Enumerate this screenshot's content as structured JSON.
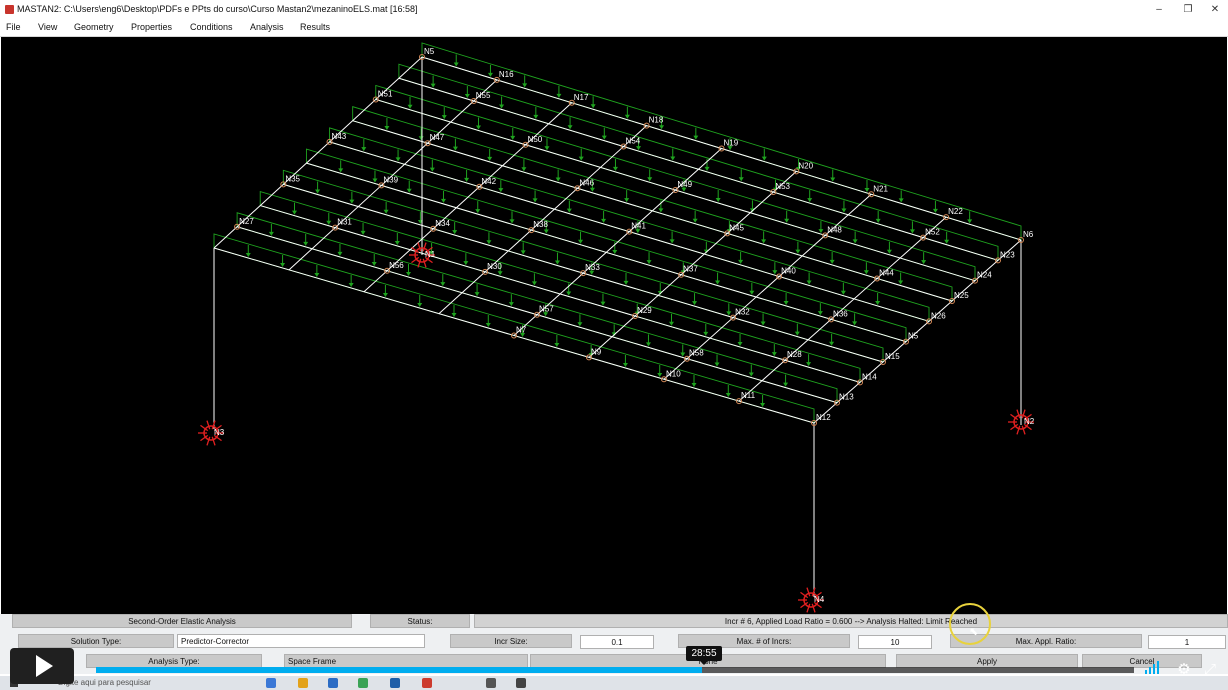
{
  "window": {
    "title": "MASTAN2:  C:\\Users\\eng6\\Desktop\\PDFs e PPts do curso\\Curso Mastan2\\mezaninoELS.mat",
    "time": "[16:58]",
    "minimize": "–",
    "restore": "❐",
    "close": "✕"
  },
  "menu": [
    "File",
    "View",
    "Geometry",
    "Properties",
    "Conditions",
    "Analysis",
    "Results"
  ],
  "nodes": {
    "primary": [
      "N5",
      "N16",
      "N17",
      "N18",
      "N19",
      "N20",
      "N21",
      "N22",
      "N6",
      "N23",
      "N24",
      "N25",
      "N26",
      "N5",
      "N15",
      "N14",
      "N13",
      "N12",
      "N11",
      "N10",
      "N9",
      "N7"
    ],
    "interior": [
      "N55",
      "N54",
      "N53",
      "N52",
      "N51",
      "N50",
      "N49",
      "N48",
      "N47",
      "N46",
      "N45",
      "N44",
      "N43",
      "N42",
      "N41",
      "N40",
      "N39",
      "N38",
      "N37",
      "N36",
      "N35",
      "N34",
      "N33",
      "N32",
      "N31",
      "N30",
      "N29",
      "N28",
      "N27",
      "N56",
      "N57",
      "N58"
    ],
    "supports": [
      "N1",
      "N2",
      "N3",
      "N4"
    ]
  },
  "panel": {
    "analysis_name": "Second-Order Elastic Analysis",
    "status_label": "Status:",
    "status_message": "Incr # 6, Applied Load Ratio = 0.600  -->  Analysis Halted: Limit Reached",
    "solution_type_label": "Solution Type:",
    "solution_type_value": "Predictor-Corrector",
    "incr_size_label": "Incr Size:",
    "incr_size_value": "0.1",
    "max_incrs_label": "Max. # of Incrs:",
    "max_incrs_value": "10",
    "max_ratio_label": "Max. Appl. Ratio:",
    "max_ratio_value": "1",
    "analysis_type_label": "Analysis Type:",
    "analysis_type_value": "Space Frame",
    "none_label": "None",
    "apply_label": "Apply",
    "cancel_label": "Cancel"
  },
  "player": {
    "time": "28:55",
    "progress": 0.584
  },
  "taskbar": {
    "search_placeholder": "Digite aqui para pesquisar"
  },
  "colors": {
    "background": "#000000",
    "members": "#ffffff",
    "loads": "#1fa31f",
    "supports": "#e02020",
    "node_circle": "#d68a58",
    "progress": "#00adef"
  }
}
